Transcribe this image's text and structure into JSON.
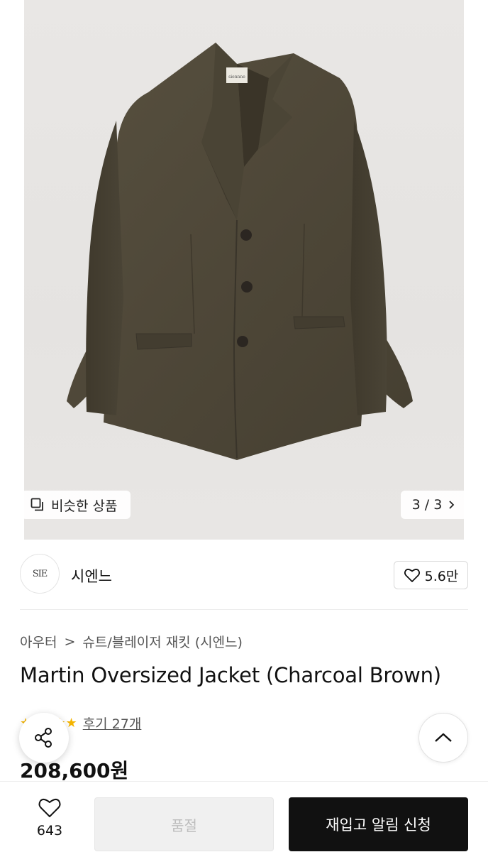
{
  "gallery": {
    "similar_label": "비슷한 상품",
    "counter": "3 / 3",
    "tag_text": "siennne"
  },
  "brand": {
    "logo_text": "SIE",
    "name": "시엔느",
    "like_count": "5.6만"
  },
  "breadcrumb": {
    "category": "아우터",
    "separator": ">",
    "subcategory": "슈트/블레이저 재킷 (시엔느)"
  },
  "product": {
    "title": "Martin Oversized Jacket (Charcoal Brown)",
    "reviews": "후기 27개",
    "price": "208,600원"
  },
  "bottom_bar": {
    "wish_count": "643",
    "soldout_label": "품절",
    "restock_label": "재입고 알림 신청"
  },
  "icons": {
    "similar": "copy-icon",
    "counter": "chevron-right-icon",
    "like": "heart-icon",
    "share": "share-icon",
    "up": "chevron-up-icon",
    "star": "star-icon"
  },
  "colors": {
    "primary_button": "#111111",
    "disabled_button": "#f0f0f0",
    "rating_star": "#f4b400"
  }
}
